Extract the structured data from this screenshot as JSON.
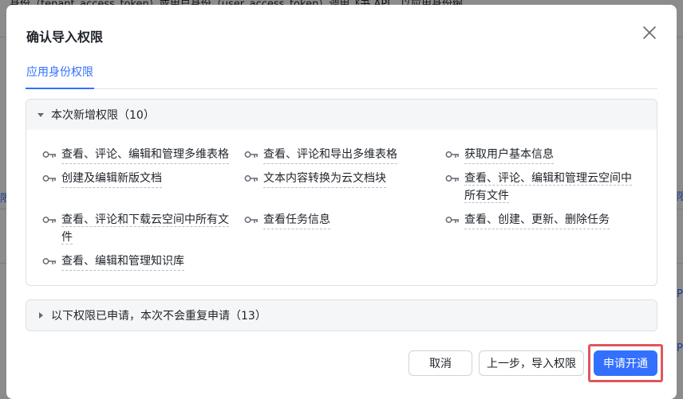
{
  "background": {
    "text": "身份（tenant_access_token）或用户身份（user_access_token）调用飞书 API，以应用身份编",
    "left_tab": "限",
    "right_1": "限",
    "right_2": "P",
    "right_tab": "P"
  },
  "modal": {
    "title": "确认导入权限",
    "tabs": [
      {
        "label": "应用身份权限"
      }
    ],
    "new_section": {
      "title": "本次新增权限（10）",
      "items": [
        {
          "label": "查看、评论、编辑和管理多维表格"
        },
        {
          "label": "查看、评论和导出多维表格"
        },
        {
          "label": "获取用户基本信息"
        },
        {
          "label": "创建及编辑新版文档"
        },
        {
          "label": "文本内容转换为云文档块"
        },
        {
          "label_line1": "查看、评论、编辑和管理云空间中",
          "label_line2": "所有文件"
        },
        {
          "label_line1": "查看、评论和下载云空间中所有文",
          "label_line2": "件"
        },
        {
          "label": "查看任务信息"
        },
        {
          "label": "查看、创建、更新、删除任务"
        },
        {
          "label": "查看、编辑和管理知识库"
        }
      ]
    },
    "applied_section": {
      "title": "以下权限已申请，本次不会重复申请（13）"
    },
    "buttons": {
      "cancel": "取消",
      "prev": "上一步，导入权限",
      "apply": "申请开通"
    }
  },
  "colors": {
    "primary": "#3370ff",
    "highlight": "#e0565b",
    "text": "#1f2329",
    "border": "#dee0e3"
  }
}
